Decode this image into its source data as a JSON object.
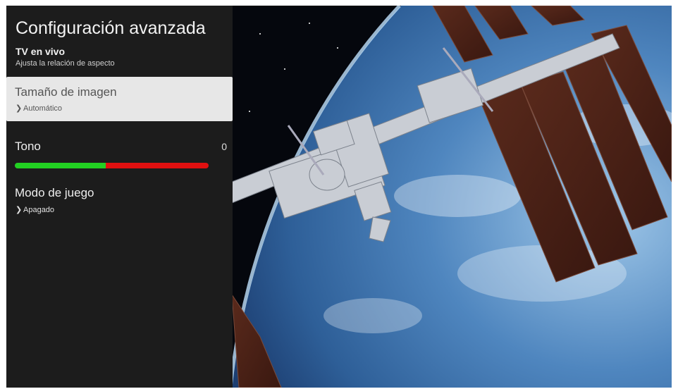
{
  "panel": {
    "title": "Configuración avanzada",
    "subtitle": "TV en vivo",
    "description": "Ajusta la relación de aspecto"
  },
  "items": [
    {
      "title": "Tamaño de imagen",
      "value": "Automático"
    },
    {
      "title": "Tono",
      "value": "0",
      "slider_fraction": 0.47
    },
    {
      "title": "Modo de juego",
      "value": "Apagado"
    }
  ],
  "colors": {
    "panel_bg": "#1c1c1c",
    "focus_bg": "#e7e7e7",
    "slider_left": "#22d022",
    "slider_right": "#e01010"
  }
}
